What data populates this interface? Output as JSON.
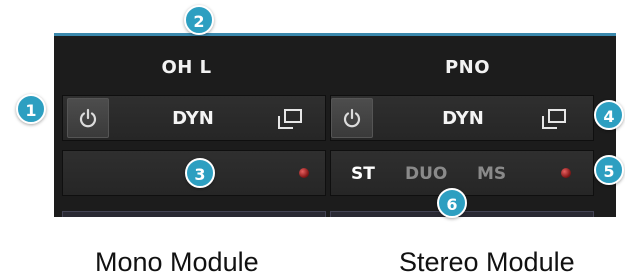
{
  "modules": {
    "mono": {
      "name": "OH L",
      "type_label": "DYN",
      "caption": "Mono Module"
    },
    "stereo": {
      "name": "PNO",
      "type_label": "DYN",
      "modes": [
        "ST",
        "DUO",
        "MS"
      ],
      "active_mode": "ST",
      "caption": "Stereo Module"
    }
  },
  "callouts": [
    "1",
    "2",
    "3",
    "4",
    "5",
    "6"
  ],
  "colors": {
    "panel": "#1c1c1c",
    "accent_line": "#3b89ad",
    "badge": "#2d9fc1",
    "led": "#c23a3a",
    "mode_active": "#ffffff",
    "mode_inactive": "#8a8a8a"
  },
  "icons": [
    "power-icon",
    "window-icon",
    "led-indicator"
  ]
}
